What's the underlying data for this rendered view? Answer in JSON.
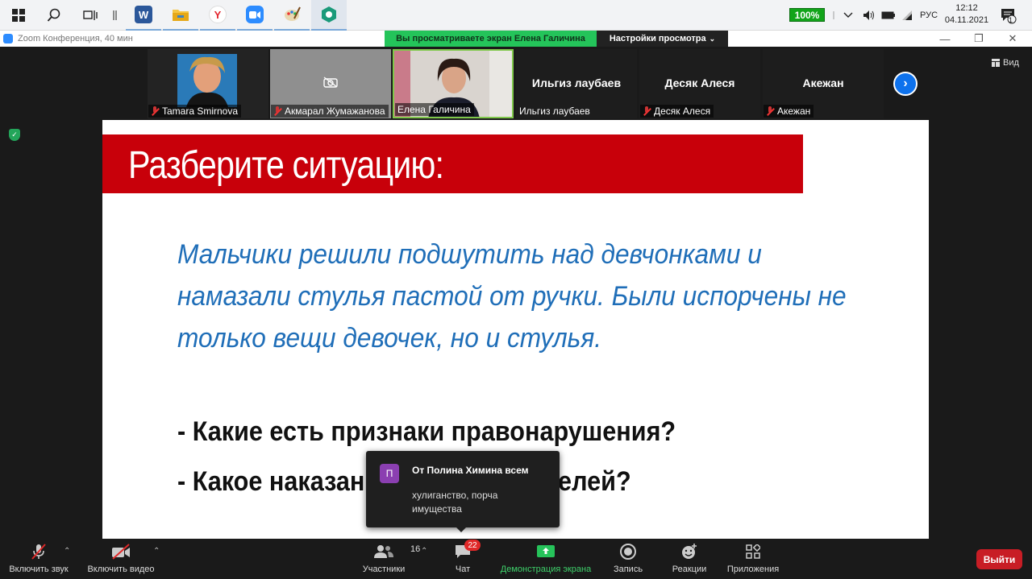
{
  "taskbar": {
    "apps": [
      {
        "name": "word",
        "glyph": "W",
        "color": "#2b579a"
      },
      {
        "name": "explorer",
        "glyph": "",
        "color": "#f0c040"
      },
      {
        "name": "yandex",
        "glyph": "Y",
        "color": "#ffffff"
      },
      {
        "name": "zoom",
        "glyph": "",
        "color": "#2d8cff"
      },
      {
        "name": "paint",
        "glyph": "",
        "color": "#e89040"
      },
      {
        "name": "app-green",
        "glyph": "",
        "color": "#1a9a7a"
      }
    ],
    "battery_percent": "100%",
    "language": "РУС",
    "time": "12:12",
    "date": "04.11.2021",
    "notification_count": "1"
  },
  "window": {
    "title": "Zoom Конференция, 40 мин",
    "share_banner": "Вы просматриваете экран Елена Галичина",
    "view_settings": "Настройки просмотра"
  },
  "participants": [
    {
      "name": "Tamara Smirnova",
      "muted": true,
      "video": "photo"
    },
    {
      "name": "Акмарал Жумажанова",
      "muted": true,
      "video": "off"
    },
    {
      "name": "Елена Галичина",
      "muted": false,
      "video": "photo"
    },
    {
      "name": "Ильгиз лаубаев",
      "display": "Ильгиз лаубаев",
      "muted": false,
      "video": "none"
    },
    {
      "name": "Десяк Алеся",
      "display": "Десяк Алеся",
      "muted": true,
      "video": "none"
    },
    {
      "name": "Акежан",
      "display": "Акежан",
      "muted": true,
      "video": "none"
    }
  ],
  "view_label": "Вид",
  "slide": {
    "title": "Разберите ситуацию:",
    "body": "Мальчики решили подшутить над девчонками и намазали стулья пастой от ручки. Были испорчены не только вещи девочек, но и стулья.",
    "questions": [
      "- Какие есть признаки правонарушения?",
      "- Какое наказание для нарушителей?"
    ]
  },
  "chat_popup": {
    "avatar_letter": "П",
    "from": "От Полина Химина всем",
    "message": "хулиганство, порча имущества"
  },
  "toolbar": {
    "audio_label": "Включить звук",
    "video_label": "Включить видео",
    "participants_label": "Участники",
    "participants_count": "16",
    "chat_label": "Чат",
    "chat_badge": "22",
    "share_label": "Демонстрация экрана",
    "record_label": "Запись",
    "reactions_label": "Реакции",
    "apps_label": "Приложения",
    "leave_label": "Выйти"
  },
  "colors": {
    "share_green": "#24c45a",
    "slide_red": "#c8000a",
    "slide_blue": "#1f6eb8",
    "leave_red": "#c81d25",
    "zoom_blue": "#0e72ed"
  }
}
